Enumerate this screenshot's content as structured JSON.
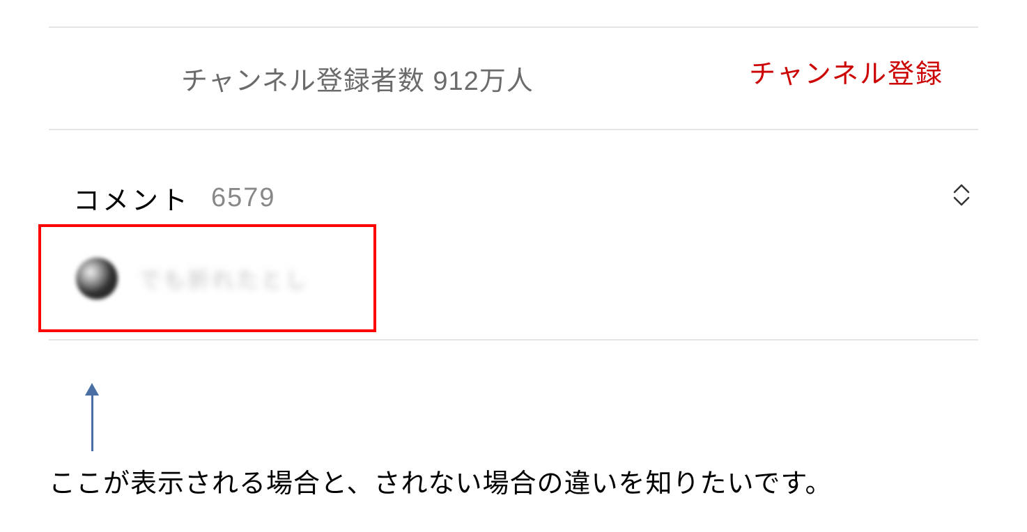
{
  "channel": {
    "subscriber_text": "チャンネル登録者数 912万人",
    "subscribe_label": "チャンネル登録"
  },
  "comments": {
    "label": "コメント",
    "count": "6579",
    "preview_text": "でも折れたとし"
  },
  "annotation": {
    "text": "ここが表示される場合と、されない場合の違いを知りたいです。"
  }
}
